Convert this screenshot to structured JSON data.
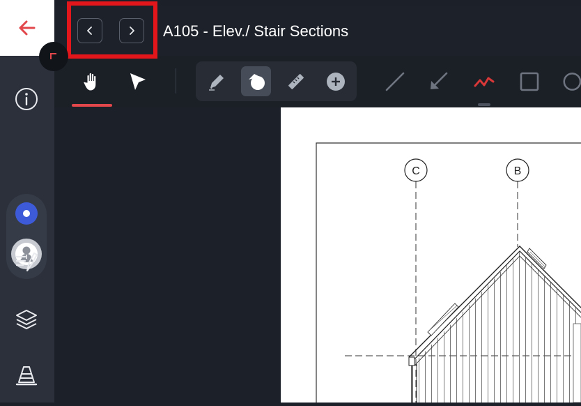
{
  "header": {
    "sheet_title": "A105 - Elev./ Stair Sections"
  },
  "drawing": {
    "grid_labels": [
      "C",
      "B"
    ]
  },
  "colors": {
    "accent_red": "#e2474b",
    "highlight_red": "#e3171b",
    "active_blue": "#3d5bd9",
    "markup_red": "#d83838"
  },
  "icons": {
    "back": "arrow-left-icon",
    "collapse": "corner-arrow-icon",
    "info": "info-icon",
    "status": "dot-icon",
    "user": "user-avatar-icon",
    "markups": "markup-list-icon",
    "layers": "layers-icon",
    "issues": "cone-icon",
    "prev": "chevron-left-icon",
    "next": "chevron-right-icon",
    "pan": "hand-icon",
    "select": "pointer-icon",
    "pen": "pen-icon",
    "shape": "shape-icon",
    "ruler": "ruler-icon",
    "add": "plus-circle-icon",
    "line": "line-icon",
    "arrow": "arrow-icon",
    "polyline": "polyline-icon",
    "rectangle": "rectangle-icon",
    "circle": "circle-icon"
  }
}
